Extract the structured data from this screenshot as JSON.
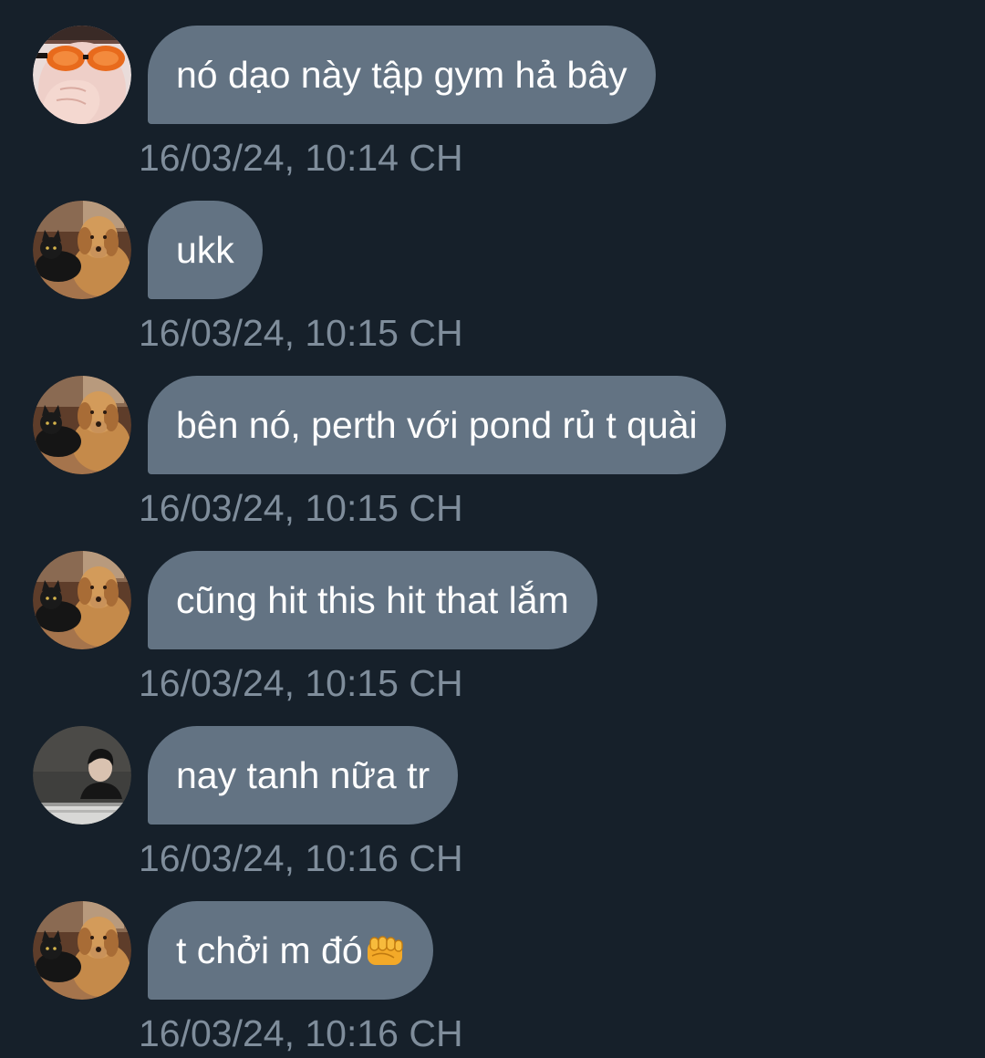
{
  "messages": [
    {
      "text": "nó dạo này tập gym hả bây",
      "time": "16/03/24, 10:14 CH",
      "avatar": "person-orange-sunglasses"
    },
    {
      "text": "ukk",
      "time": "16/03/24, 10:15 CH",
      "avatar": "golden-retriever-and-black-cat"
    },
    {
      "text": "bên nó, perth với pond rủ t quài",
      "time": "16/03/24, 10:15 CH",
      "avatar": "golden-retriever-and-black-cat"
    },
    {
      "text": "cũng hit this hit that lắm",
      "time": "16/03/24, 10:15 CH",
      "avatar": "golden-retriever-and-black-cat"
    },
    {
      "text": "nay tanh nữa tr",
      "time": "16/03/24, 10:16 CH",
      "avatar": "person-at-desk"
    },
    {
      "text": "t chởi m đó",
      "time": "16/03/24, 10:16 CH",
      "avatar": "golden-retriever-and-black-cat",
      "emoji": "oncoming-fist"
    }
  ],
  "colors": {
    "background": "#16202a",
    "bubble": "#637383",
    "bubble_text": "#ffffff",
    "timestamp": "#7f8d9b"
  }
}
